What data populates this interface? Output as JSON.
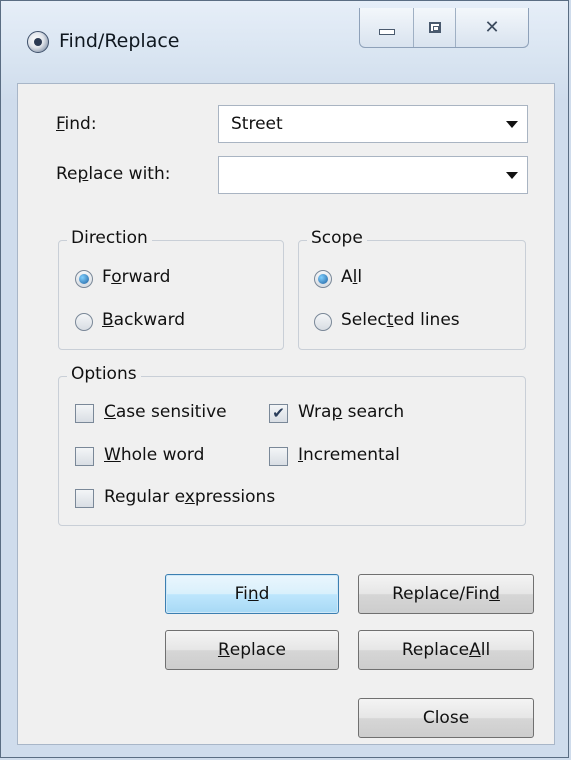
{
  "window": {
    "title": "Find/Replace",
    "caption_buttons": {
      "minimize_icon": "minimize-icon",
      "maximize_icon": "maximize-icon",
      "close_glyph": "✕"
    }
  },
  "find": {
    "label_pre": "",
    "label_ul": "F",
    "label_post": "ind:",
    "value": "Street"
  },
  "replace": {
    "label_pre": "Re",
    "label_ul": "p",
    "label_post": "lace with:",
    "value": ""
  },
  "direction": {
    "title": "Direction",
    "options": [
      {
        "pre": "F",
        "ul": "o",
        "post": "rward",
        "checked": true
      },
      {
        "pre": "",
        "ul": "B",
        "post": "ackward",
        "checked": false
      }
    ]
  },
  "scope": {
    "title": "Scope",
    "options": [
      {
        "pre": "A",
        "ul": "l",
        "post": "l",
        "checked": true
      },
      {
        "pre": "Selec",
        "ul": "t",
        "post": "ed lines",
        "checked": false
      }
    ]
  },
  "options": {
    "title": "Options",
    "items": [
      {
        "pre": "",
        "ul": "C",
        "post": "ase sensitive",
        "checked": false
      },
      {
        "pre": "Wra",
        "ul": "p",
        "post": " search",
        "checked": true
      },
      {
        "pre": "",
        "ul": "W",
        "post": "hole word",
        "checked": false
      },
      {
        "pre": "",
        "ul": "I",
        "post": "ncremental",
        "checked": false
      },
      {
        "pre": "Regular e",
        "ul": "x",
        "post": "pressions",
        "checked": false
      }
    ]
  },
  "buttons": {
    "find": {
      "pre": "Fi",
      "ul": "n",
      "post": "d"
    },
    "replace_find": {
      "pre": "Replace/Fin",
      "ul": "d",
      "post": ""
    },
    "replace": {
      "pre": "",
      "ul": "R",
      "post": "eplace"
    },
    "replace_all": {
      "pre": "Replace ",
      "ul": "A",
      "post": "ll"
    },
    "close": {
      "pre": "Close",
      "ul": "",
      "post": ""
    }
  },
  "check_glyph": "✔"
}
